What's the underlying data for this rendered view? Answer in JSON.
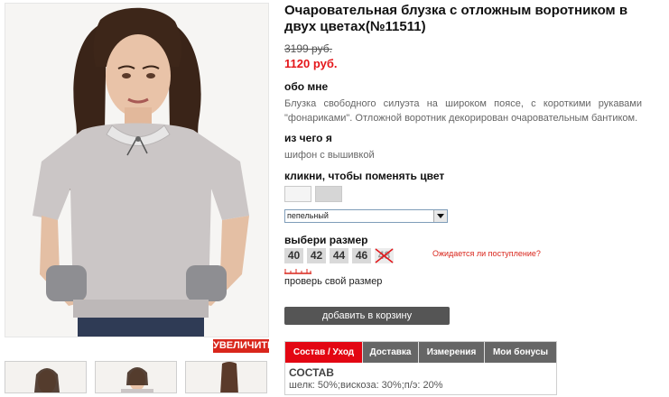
{
  "product": {
    "title": "Очаровательная блузка с отложным воротником в двух цветах(№11511)",
    "old_price": "3199 руб.",
    "new_price": "1120 руб."
  },
  "about": {
    "heading": "обо мне",
    "text": "Блузка свободного силуэта на широком поясе, с короткими рукавами \"фонариками\". Отложной воротник декорирован очаровательным бантиком."
  },
  "material": {
    "heading": "из чего я",
    "text": "шифон с вышивкой"
  },
  "color": {
    "heading": "кликни, чтобы поменять цвет",
    "swatches": [
      "#f4f4f4",
      "#d6d6d6"
    ],
    "selected": "пепельный"
  },
  "sizes": {
    "heading": "выбери размер",
    "items": [
      {
        "label": "40",
        "available": true
      },
      {
        "label": "42",
        "available": true
      },
      {
        "label": "44",
        "available": true
      },
      {
        "label": "46",
        "available": true
      },
      {
        "label": "48",
        "available": false
      }
    ],
    "restock_link": "Ожидается ли поступление?",
    "check_size": "проверь свой размер"
  },
  "cart_button": "добавить в корзину",
  "zoom_button": "УВЕЛИЧИТЬ",
  "tabs": [
    {
      "label": "Состав / Уход",
      "active": true
    },
    {
      "label": "Доставка",
      "active": false
    },
    {
      "label": "Измерения",
      "active": false
    },
    {
      "label": "Мои бонусы",
      "active": false
    }
  ],
  "composition": {
    "heading": "СОСТАВ",
    "text": "шелк: 50%;вискоза: 30%;п/э: 20%"
  },
  "colors": {
    "accent_red": "#e30613",
    "price_red": "#e4161a",
    "button_dark": "#555555"
  }
}
